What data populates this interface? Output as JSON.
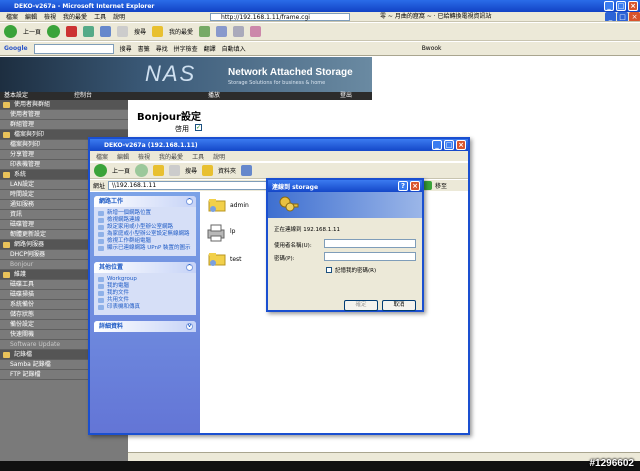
{
  "ie": {
    "title": "DEKO-v267a - Microsoft Internet Explorer",
    "menu": [
      "檔案",
      "編輯",
      "檢視",
      "我的最愛",
      "工具",
      "說明"
    ],
    "address": "http://192.168.1.11/frame.cgi",
    "message_tab": "零 ~ 月曲的窟窩 ~ · 已給轉換電視資訊站",
    "toolbar": {
      "back": "上一頁",
      "search": "搜尋",
      "favorites": "我的最愛"
    },
    "google": {
      "label": "Google",
      "items": [
        "搜尋",
        "書籤",
        "尋找",
        "拼字檢查",
        "翻譯",
        "自動填入"
      ],
      "user": "Bwook"
    }
  },
  "banner": {
    "logo": "NAS",
    "title": "Network Attached Storage",
    "subtitle": "Storage Solutions for business & home"
  },
  "navbar": [
    "基本設定",
    "控制台",
    "播放",
    "登出"
  ],
  "sidebar": {
    "items": [
      {
        "label": "使用者與群組",
        "head": true
      },
      {
        "label": "使用者管理"
      },
      {
        "label": "群組管理"
      },
      {
        "label": "檔案與列印",
        "head": true
      },
      {
        "label": "檔案與列印"
      },
      {
        "label": "分享管理"
      },
      {
        "label": "印表機管理"
      },
      {
        "label": "系統",
        "head": true
      },
      {
        "label": "LAN設定"
      },
      {
        "label": "時間設定"
      },
      {
        "label": "通知服務"
      },
      {
        "label": "資訊"
      },
      {
        "label": "磁碟管理"
      },
      {
        "label": "韌體更新設定"
      },
      {
        "label": "網路伺服器",
        "head": true
      },
      {
        "label": "DHCP伺服器"
      },
      {
        "label": "Bonjour",
        "dim": true
      },
      {
        "label": "維護",
        "head": true
      },
      {
        "label": "磁碟工具"
      },
      {
        "label": "磁碟掃描"
      },
      {
        "label": "系統備份"
      },
      {
        "label": "儲存狀態"
      },
      {
        "label": "備份設定"
      },
      {
        "label": "快速關機"
      },
      {
        "label": "Software Update",
        "dim": true
      },
      {
        "label": "記錄檔",
        "head": true
      },
      {
        "label": "Samba 記錄檔"
      },
      {
        "label": "FTP 記錄檔"
      }
    ]
  },
  "main": {
    "heading": "Bonjour設定",
    "enable_label": "啓用"
  },
  "explorer": {
    "title": "DEKO-v267a (192.168.1.11)",
    "menu": [
      "檔案",
      "編輯",
      "檢視",
      "我的最愛",
      "工具",
      "說明"
    ],
    "toolbar": {
      "back": "上一頁",
      "search": "搜尋",
      "folders": "資料夾"
    },
    "address_label": "網址",
    "address": "\\\\192.168.1.11",
    "go": "移至",
    "panels": [
      {
        "title": "網路工作",
        "links": [
          "新增一個網路位置",
          "檢視網路連線",
          "設定家用或小型辦公室網路",
          "為家庭或小型辦公室設定無線網路",
          "檢視工作群組電腦",
          "顯示已連線網路 UPnP 裝置的圖示"
        ]
      },
      {
        "title": "其他位置",
        "links": [
          "Workgroup",
          "我的電腦",
          "我的文件",
          "共用文件",
          "印表機和傳真"
        ]
      },
      {
        "title": "詳細資料",
        "links": []
      }
    ],
    "files": [
      {
        "name": "admin",
        "icon": "shared-folder-icon"
      },
      {
        "name": "lp",
        "icon": "printer-icon"
      },
      {
        "name": "test",
        "icon": "shared-folder-icon"
      }
    ]
  },
  "login": {
    "title": "連線到 storage",
    "connecting": "正在連線到 192.168.1.11",
    "username_label": "使用者名稱(U):",
    "username_value": "",
    "password_label": "密碼(P):",
    "remember": "記憶我的密碼(R)",
    "ok": "確定",
    "cancel": "取消"
  },
  "watermark": "#1296602",
  "colors": {
    "xp_blue": "#1a4fd0",
    "sidebar": "#7a7a7a",
    "panel_link": "#215dc6"
  }
}
